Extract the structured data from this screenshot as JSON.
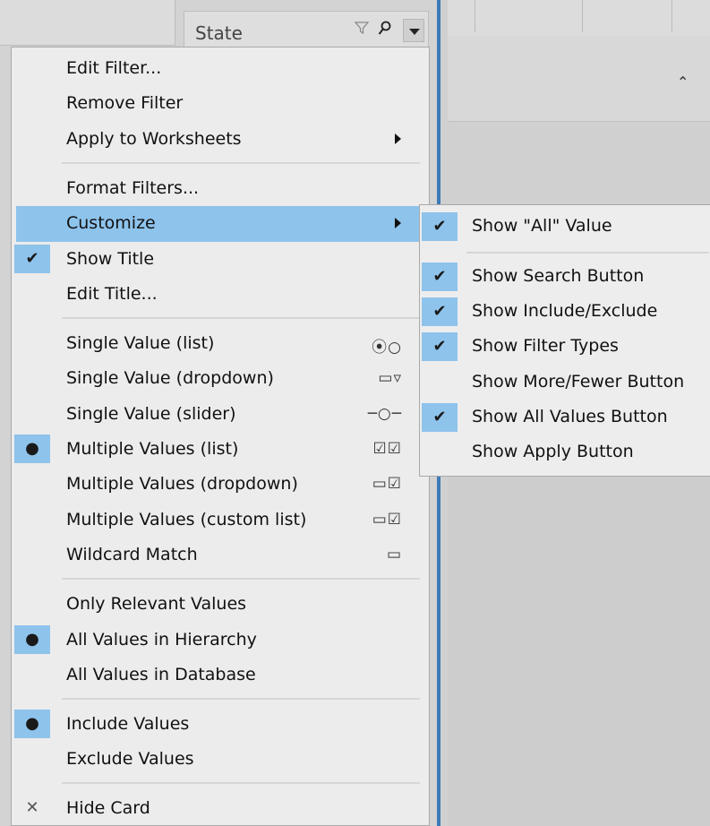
{
  "filter_card": {
    "title": "State",
    "filter_icon": "funnel-icon",
    "search_icon": "magnifier-icon",
    "dropdown_icon": "chevron-down-icon"
  },
  "colors": {
    "highlight": "#8ec3ec",
    "menu_bg": "#ececec",
    "accent_line": "#3d7ab7"
  },
  "menu": {
    "edit_filter": "Edit Filter...",
    "remove_filter": "Remove Filter",
    "apply_to_worksheets": "Apply to Worksheets",
    "format_filters": "Format Filters...",
    "customize": "Customize",
    "show_title": "Show Title",
    "edit_title": "Edit Title...",
    "modes": [
      {
        "label": "Single Value (list)",
        "icon": "radio-list-icon",
        "glyph": "⦿○"
      },
      {
        "label": "Single Value (dropdown)",
        "icon": "dropdown-icon",
        "glyph": "▭▿"
      },
      {
        "label": "Single Value (slider)",
        "icon": "slider-icon",
        "glyph": "─○─"
      },
      {
        "label": "Multiple Values (list)",
        "icon": "checkbox-list-icon",
        "glyph": "☑☑",
        "selected": true
      },
      {
        "label": "Multiple Values (dropdown)",
        "icon": "multi-dropdown-icon",
        "glyph": "▭☑"
      },
      {
        "label": "Multiple Values (custom list)",
        "icon": "custom-list-icon",
        "glyph": "▭☑"
      },
      {
        "label": "Wildcard Match",
        "icon": "wildcard-icon",
        "glyph": "▭"
      }
    ],
    "only_relevant": "Only Relevant Values",
    "all_in_hierarchy": "All Values in Hierarchy",
    "all_in_database": "All Values in Database",
    "include_values": "Include Values",
    "exclude_values": "Exclude Values",
    "hide_card": "Hide Card"
  },
  "submenu": {
    "items": [
      {
        "label": "Show \"All\" Value",
        "checked": true
      },
      {
        "label": "Show Search Button",
        "checked": true
      },
      {
        "label": "Show Include/Exclude",
        "checked": true
      },
      {
        "label": "Show Filter Types",
        "checked": true
      },
      {
        "label": "Show More/Fewer Button",
        "checked": false
      },
      {
        "label": "Show All Values Button",
        "checked": true
      },
      {
        "label": "Show Apply Button",
        "checked": false
      }
    ]
  }
}
